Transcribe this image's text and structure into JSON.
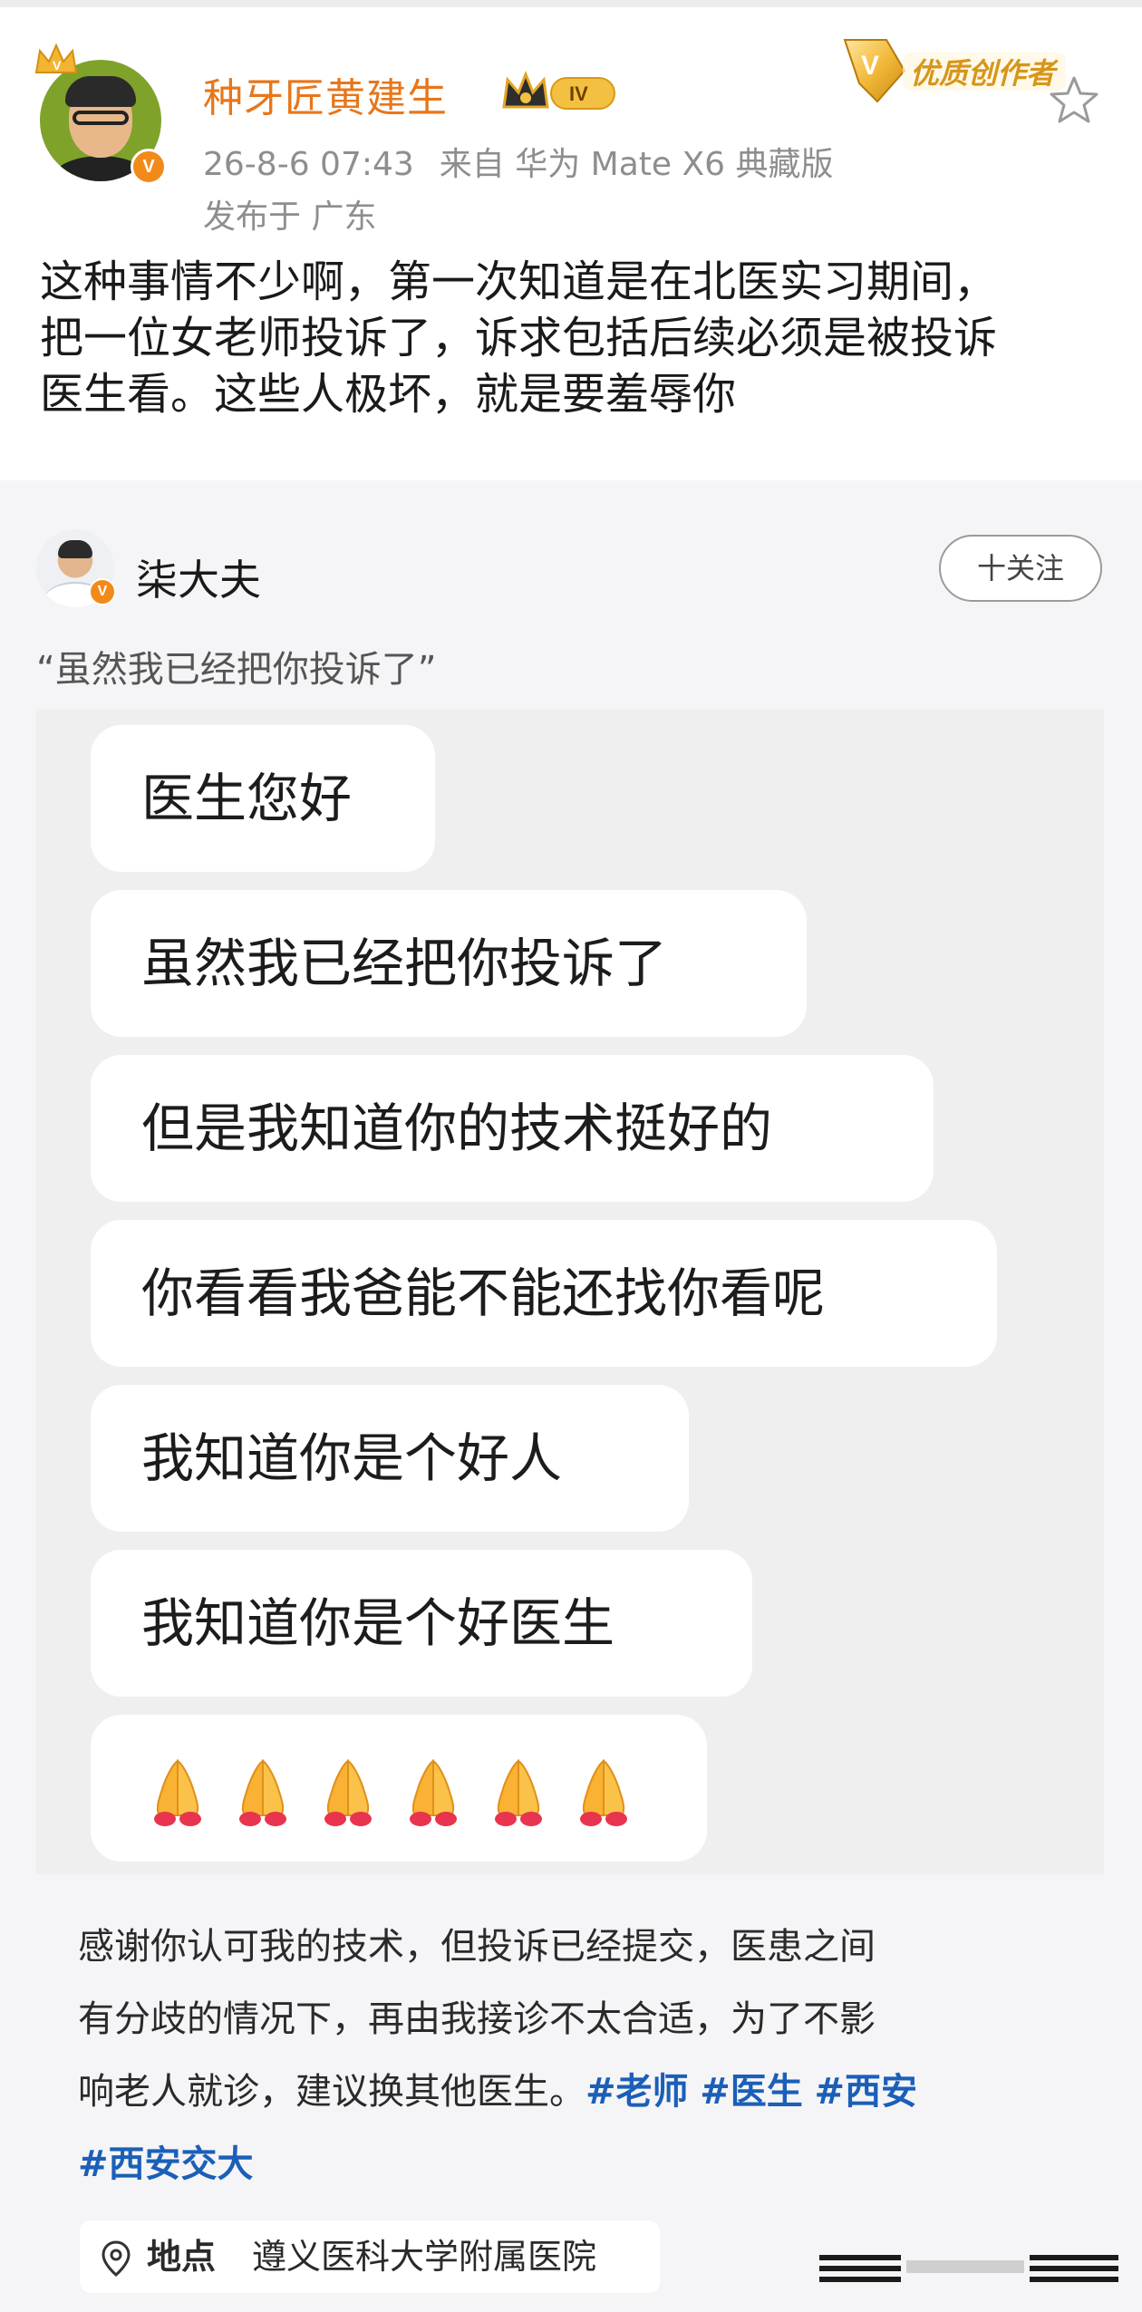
{
  "post": {
    "author": "种牙匠黄建生",
    "level_badge": "IV",
    "timestamp": "26-8-6 07:43",
    "source": "来自 华为 Mate X6 典藏版",
    "location": "发布于 广东",
    "creator_badge": "优质创作者",
    "text_lines": [
      "这种事情不少啊，第一次知道是在北医实习期间，",
      "把一位女老师投诉了，诉求包括后续必须是被投诉",
      "医生看。这些人极坏，就是要羞辱你"
    ]
  },
  "quoted": {
    "author": "柒大夫",
    "follow_label": "十关注",
    "quote": "“虽然我已经把你投诉了”",
    "messages": [
      "医生您好",
      "虽然我已经把你投诉了",
      "但是我知道你的技术挺好的",
      "你看看我爸能不能还找你看呢",
      "我知道你是个好人",
      "我知道你是个好医生"
    ],
    "emoji_count": 6,
    "reply": {
      "line1": "感谢你认可我的技术，但投诉已经提交，医患之间",
      "line2": "有分歧的情况下，再由我接诊不太合适，为了不影",
      "line3_text": "响老人就诊，建议换其他医生。",
      "tags": [
        "#老师",
        "#医生",
        "#西安",
        "#西安交大"
      ]
    },
    "location_label": "地点",
    "location_value": "遵义医科大学附属医院"
  },
  "colors": {
    "author_orange": "#e8761a",
    "tag_blue": "#1b5fb8",
    "verified_orange": "#f28a1a"
  },
  "icons": [
    "crown-icon",
    "verified-icon",
    "star-icon",
    "pin-icon",
    "praying-hands-icon",
    "more-lines-icon"
  ]
}
